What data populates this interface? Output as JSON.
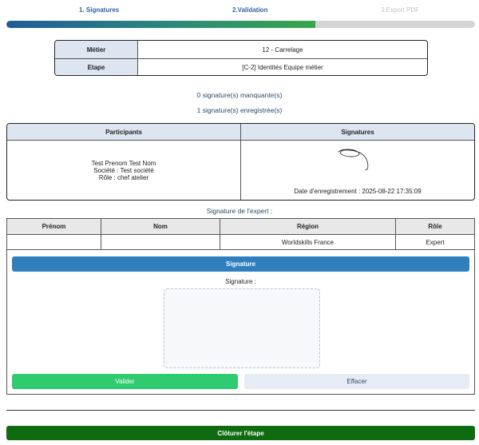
{
  "steps": [
    {
      "label": "1. Signatures",
      "state": "active"
    },
    {
      "label": "2.Validation",
      "state": "active"
    },
    {
      "label": "3.Export PDF",
      "state": "disabled"
    }
  ],
  "progress": {
    "percent": 66
  },
  "meta": {
    "metier_label": "Métier",
    "metier_value": "12 - Carrelage",
    "etape_label": "Etape",
    "etape_value": "[C-2] Identités Equipe métier"
  },
  "counts": {
    "missing": "0 signature(s) manquante(s)",
    "recorded": "1 signature(s) enregistrée(s)"
  },
  "participants_table": {
    "col_participants": "Participants",
    "col_signatures": "Signatures",
    "rows": [
      {
        "name": "Test Prenom Test Nom",
        "company": "Société : Test société",
        "role": "Rôle : chef atelier",
        "signature_date": "Date d'enregistrement : 2025-08-22 17:35:09"
      }
    ]
  },
  "expert": {
    "title": "Signature de l'expert :",
    "headers": [
      "Prénom",
      "Nom",
      "Région",
      "Rôle"
    ],
    "row": [
      "",
      "",
      "Worldskills France",
      "Expert"
    ]
  },
  "signature_panel": {
    "bar_label": "Signature",
    "pad_label": "Signature :",
    "validate_label": "Valider",
    "clear_label": "Effacer"
  },
  "footer": {
    "close_label": "Clôturer l'étape"
  },
  "colors": {
    "primary": "#2f7fbf",
    "success": "#2ecc6f",
    "dark_green": "#0f6b0f",
    "header_bg": "#dde5f0"
  }
}
